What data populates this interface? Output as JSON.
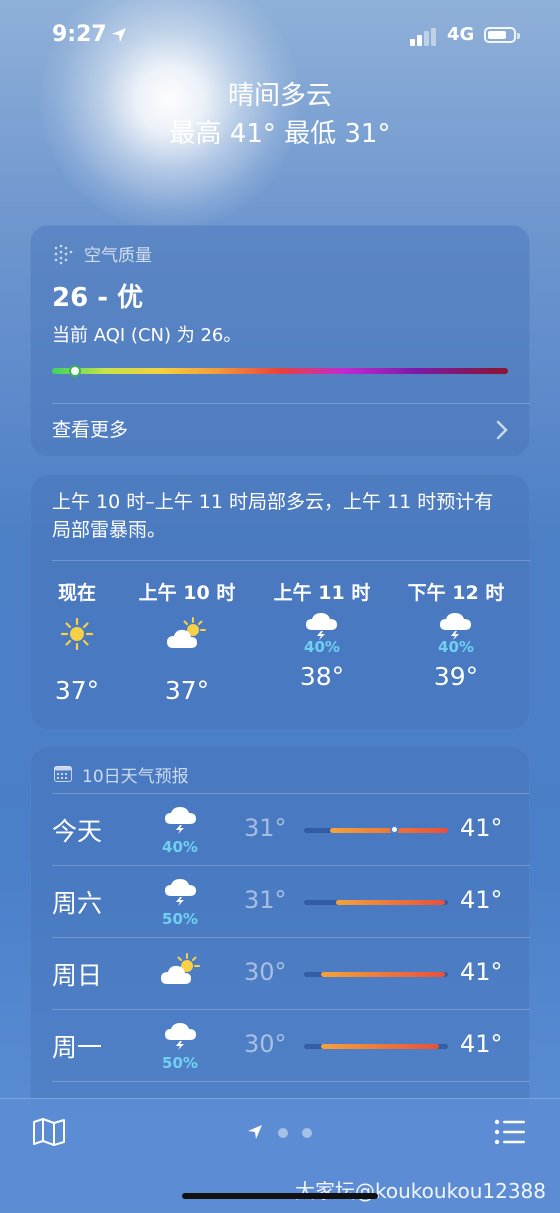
{
  "status": {
    "time": "9:27",
    "network": "4G"
  },
  "hero": {
    "condition": "晴间多云",
    "hilo": "最高 41°  最低 31°"
  },
  "aqi": {
    "title": "空气质量",
    "value": "26 - 优",
    "description": "当前 AQI (CN) 为 26。",
    "level": 0.05,
    "more": "查看更多"
  },
  "hourly": {
    "summary": "上午 10 时–上午 11 时局部多云，上午 11 时预计有局部雷暴雨。",
    "items": [
      {
        "label": "现在",
        "icon": "sun-icon",
        "pct": "",
        "temp": "37°"
      },
      {
        "label": "上午 10 时",
        "icon": "partly-cloudy-icon",
        "pct": "",
        "temp": "37°"
      },
      {
        "label": "上午 11 时",
        "icon": "thunderstorm-icon",
        "pct": "40%",
        "temp": "38°"
      },
      {
        "label": "下午 12 时",
        "icon": "thunderstorm-icon",
        "pct": "40%",
        "temp": "39°"
      }
    ]
  },
  "daily": {
    "title": "10日天气预报",
    "rows": [
      {
        "day": "今天",
        "icon": "thunderstorm-icon",
        "pct": "40%",
        "low": "31°",
        "high": "41°",
        "range_start": 0.18,
        "range_end": 1.0,
        "current": 0.63
      },
      {
        "day": "周六",
        "icon": "thunderstorm-icon",
        "pct": "50%",
        "low": "31°",
        "high": "41°",
        "range_start": 0.22,
        "range_end": 0.98
      },
      {
        "day": "周日",
        "icon": "partly-cloudy-icon",
        "pct": "",
        "low": "30°",
        "high": "41°",
        "range_start": 0.12,
        "range_end": 0.98
      },
      {
        "day": "周一",
        "icon": "thunderstorm-icon",
        "pct": "50%",
        "low": "30°",
        "high": "41°",
        "range_start": 0.12,
        "range_end": 0.94
      }
    ]
  },
  "tabbar": {
    "page_count": 3,
    "active_page": 0
  },
  "watermark": "大家坛@koukoukou12388",
  "colors": {
    "precip": "#6fd0f2",
    "sun": "#f6d046"
  }
}
